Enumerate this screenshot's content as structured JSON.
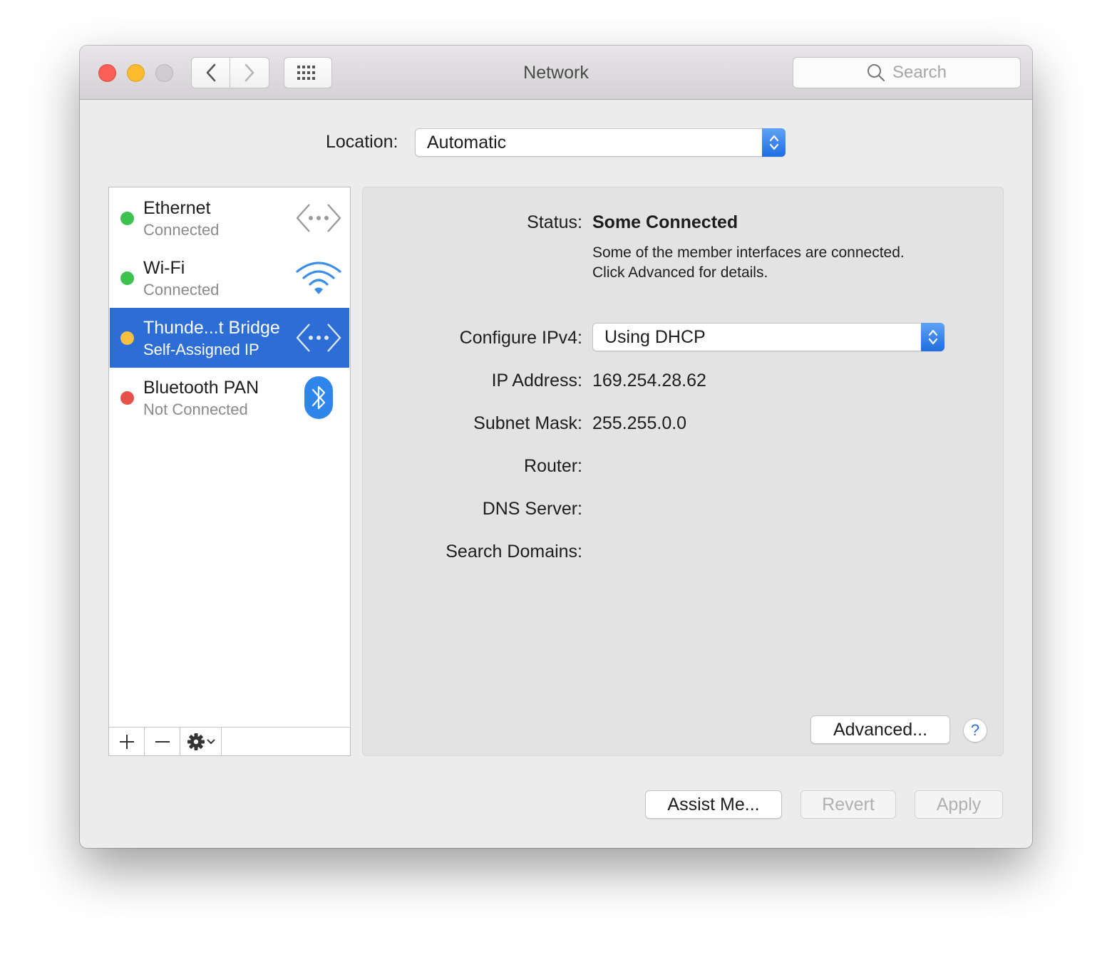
{
  "window": {
    "title": "Network",
    "search_placeholder": "Search"
  },
  "location": {
    "label": "Location:",
    "value": "Automatic"
  },
  "services": [
    {
      "name": "Ethernet",
      "status": "Connected",
      "dot_color": "#3bc24f",
      "icon": "ethernet-icon"
    },
    {
      "name": "Wi-Fi",
      "status": "Connected",
      "dot_color": "#3bc24f",
      "icon": "wifi-icon"
    },
    {
      "name": "Thunde...t Bridge",
      "status": "Self-Assigned IP",
      "dot_color": "#f7c042",
      "icon": "ethernet-icon",
      "selected": true
    },
    {
      "name": "Bluetooth PAN",
      "status": "Not Connected",
      "dot_color": "#e8514a",
      "icon": "bluetooth-icon"
    }
  ],
  "detail": {
    "status_label": "Status:",
    "status_value": "Some Connected",
    "status_desc_line1": "Some of the member interfaces are connected.",
    "status_desc_line2": "Click Advanced for details.",
    "ipv4_label": "Configure IPv4:",
    "ipv4_value": "Using DHCP",
    "ip_label": "IP Address:",
    "ip_value": "169.254.28.62",
    "subnet_label": "Subnet Mask:",
    "subnet_value": "255.255.0.0",
    "router_label": "Router:",
    "dns_label": "DNS Server:",
    "search_domains_label": "Search Domains:",
    "advanced_button": "Advanced...",
    "help_button": "?"
  },
  "footer": {
    "assist_button": "Assist Me...",
    "revert_button": "Revert",
    "apply_button": "Apply"
  },
  "colors": {
    "selection": "#2c6ed6",
    "popup_accent": "#1e6ee0"
  }
}
